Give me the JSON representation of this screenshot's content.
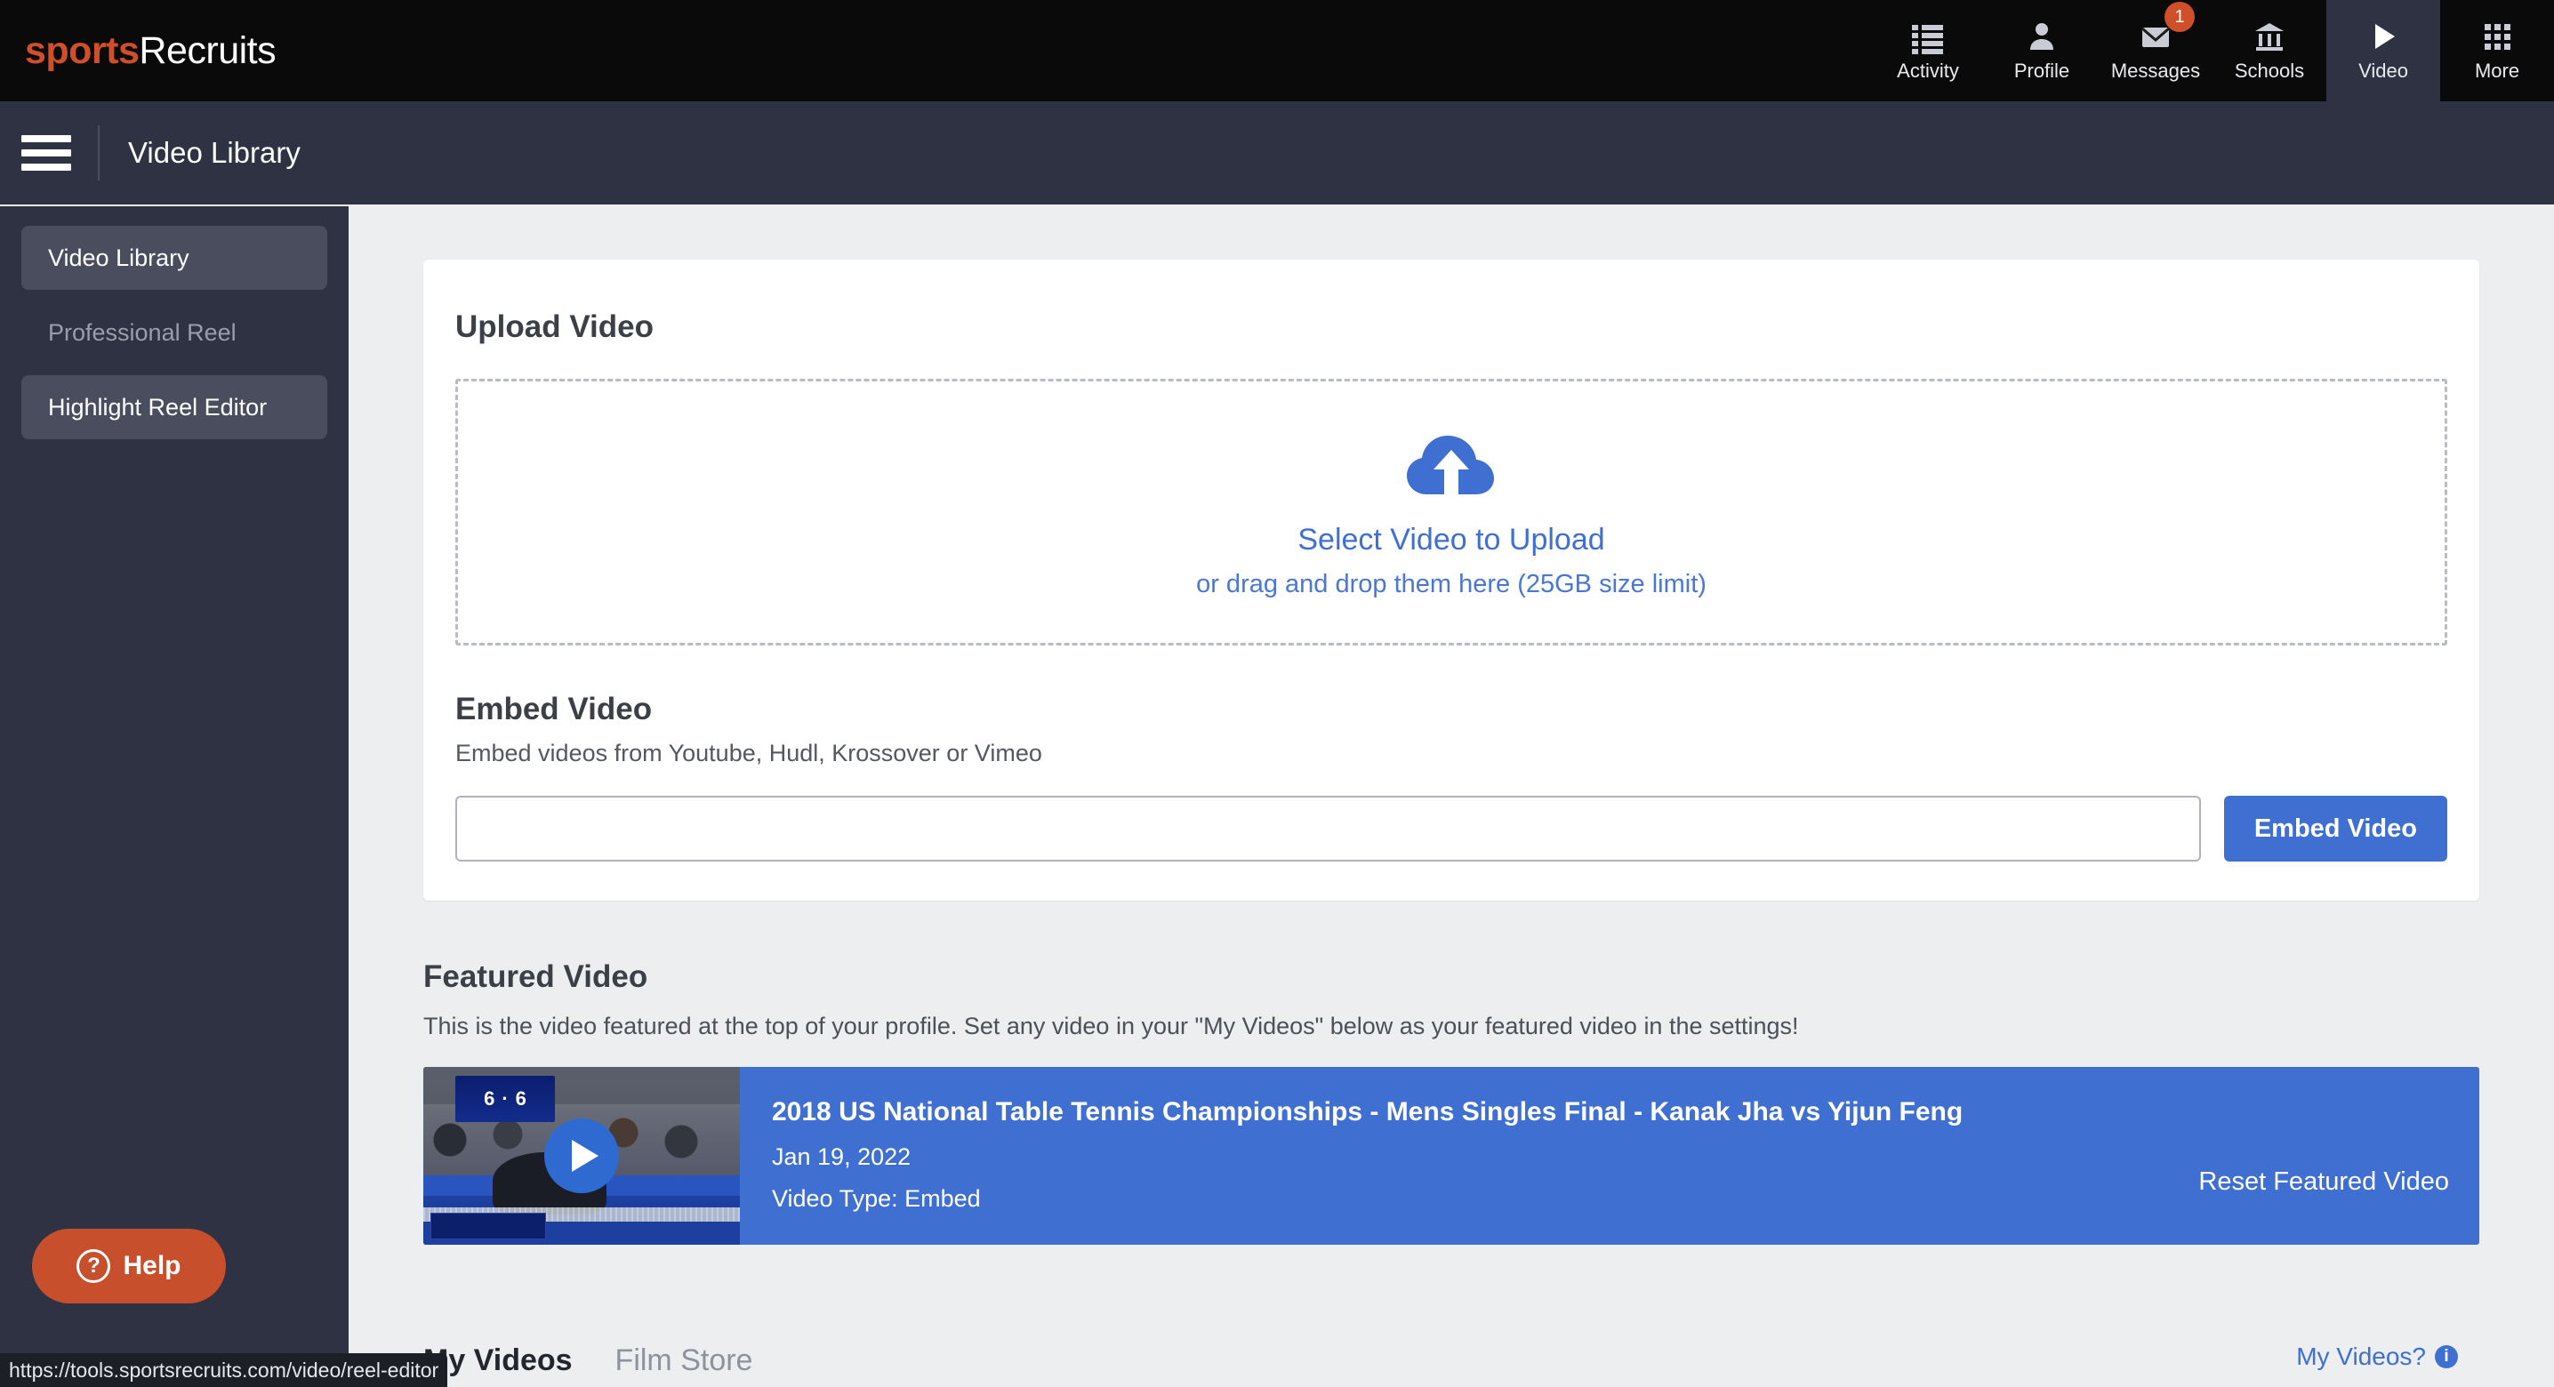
{
  "brand": {
    "part1": "sports",
    "part2": "Recruits"
  },
  "topnav": [
    {
      "label": "Activity",
      "icon": "list-icon",
      "active": false
    },
    {
      "label": "Profile",
      "icon": "person-icon",
      "active": false
    },
    {
      "label": "Messages",
      "icon": "envelope-icon",
      "badge": "1",
      "active": false
    },
    {
      "label": "Schools",
      "icon": "bank-icon",
      "active": false
    },
    {
      "label": "Video",
      "icon": "play-icon",
      "active": true
    },
    {
      "label": "More",
      "icon": "grid-icon",
      "active": false
    }
  ],
  "subheader": {
    "menu_icon": "hamburger-icon",
    "title": "Video Library"
  },
  "sidebar": {
    "items": [
      {
        "label": "Video Library",
        "state": "selected"
      },
      {
        "label": "Professional Reel",
        "state": "disabled"
      },
      {
        "label": "Highlight Reel Editor",
        "state": "hover"
      }
    ]
  },
  "upload": {
    "heading": "Upload Video",
    "icon": "cloud-upload-icon",
    "primary": "Select Video to Upload",
    "secondary": "or drag and drop them here (25GB size limit)"
  },
  "embed": {
    "heading": "Embed Video",
    "subtext": "Embed videos from Youtube, Hudl, Krossover or Vimeo",
    "input_value": "",
    "input_placeholder": "",
    "button": "Embed Video"
  },
  "featured": {
    "heading": "Featured Video",
    "description": "This is the video featured at the top of your profile. Set any video in your \"My Videos\" below as your featured video in the settings!",
    "video": {
      "title": "2018 US National Table Tennis Championships - Mens Singles Final - Kanak Jha vs Yijun Feng",
      "date": "Jan 19, 2022",
      "type": "Video Type: Embed",
      "thumbnail_score_left": "6",
      "thumbnail_score_dot": "·",
      "thumbnail_score_right": "6"
    },
    "reset_link": "Reset Featured Video"
  },
  "bottom_tabs": [
    {
      "label": "My Videos",
      "active": true
    },
    {
      "label": "Film Store",
      "active": false
    }
  ],
  "my_videos_link": {
    "label": "My Videos?",
    "icon": "info-icon",
    "icon_glyph": "i"
  },
  "help_widget": {
    "label": "Help",
    "icon": "question-icon",
    "glyph": "?"
  },
  "status_bar": {
    "url": "https://tools.sportsrecruits.com/video/reel-editor"
  },
  "colors": {
    "brand_orange": "#d04f2b",
    "accent_blue": "#3f6fd0",
    "dark_nav": "#0a0a0a",
    "slate": "#2e3242",
    "page_bg": "#eceef0"
  }
}
